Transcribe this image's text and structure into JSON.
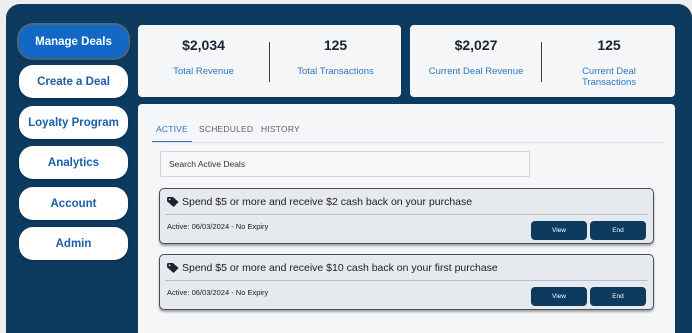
{
  "sidebar": {
    "items": [
      {
        "label": "Manage Deals"
      },
      {
        "label": "Create a Deal"
      },
      {
        "label": "Loyalty Program"
      },
      {
        "label": "Analytics"
      },
      {
        "label": "Account"
      },
      {
        "label": "Admin"
      }
    ]
  },
  "stats": [
    {
      "value": "$2,034",
      "label": "Total Revenue"
    },
    {
      "value": "125",
      "label": "Total Transactions"
    },
    {
      "value": "$2,027",
      "label": "Current Deal Revenue"
    },
    {
      "value": "125",
      "label": "Current Deal Transactions"
    }
  ],
  "tabs": [
    {
      "label": "ACTIVE"
    },
    {
      "label": "SCHEDULED"
    },
    {
      "label": "HISTORY"
    }
  ],
  "search": {
    "placeholder": "Search Active Deals"
  },
  "deals": [
    {
      "title": "Spend $5 or more and receive $2 cash back on your purchase",
      "status": "Active: 06/03/2024 - No Expiry",
      "view_label": "View",
      "end_label": "End"
    },
    {
      "title": "Spend $5 or more and receive $10 cash back on your first purchase",
      "status": "Active: 06/03/2024 - No Expiry",
      "view_label": "View",
      "end_label": "End"
    }
  ],
  "icons": {
    "deal": "tag-icon"
  },
  "colors": {
    "brand_navy": "#0d3a5f",
    "accent_blue": "#1268c4",
    "link_blue": "#2a78c4"
  }
}
